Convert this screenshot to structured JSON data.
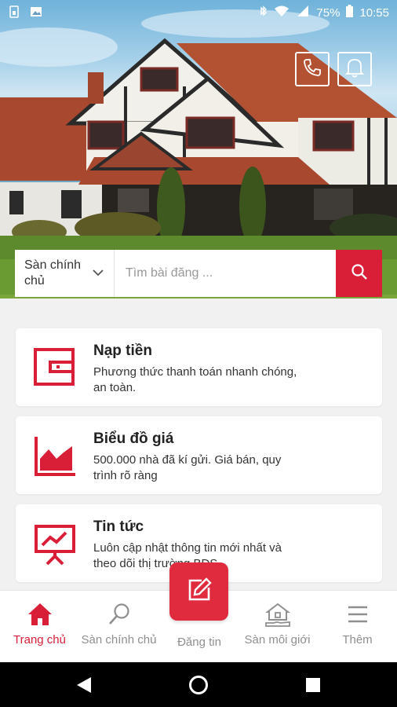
{
  "status_bar": {
    "battery": "75%",
    "time": "10:55",
    "icons": [
      "sim-icon",
      "image-icon",
      "bluetooth-icon",
      "wifi-icon",
      "signal-icon",
      "battery-icon"
    ]
  },
  "header": {
    "buttons": [
      "phone-icon",
      "bell-icon"
    ]
  },
  "search": {
    "category": "Sàn chính chủ",
    "placeholder": "Tìm bài đăng ...",
    "value": ""
  },
  "cards": [
    {
      "title": "Nạp tiền",
      "desc": "Phương thức thanh toán nhanh chóng, an toàn.",
      "icon": "wallet-icon"
    },
    {
      "title": "Biểu đồ giá",
      "desc": "500.000 nhà đã kí gửi. Giá bán, quy trình rõ ràng",
      "icon": "area-chart-icon"
    },
    {
      "title": "Tin tức",
      "desc": "Luôn cập nhật thông tin mới nhất và theo dõi thị trường BĐS",
      "icon": "presentation-icon"
    }
  ],
  "nav": {
    "items": [
      {
        "label": "Trang chủ",
        "icon": "home-icon",
        "active": true
      },
      {
        "label": "Sàn chính chủ",
        "icon": "search-icon",
        "active": false
      },
      {
        "label": "Đăng tin",
        "icon": "edit-icon",
        "active": false
      },
      {
        "label": "Sàn môi giới",
        "icon": "house-hand-icon",
        "active": false
      },
      {
        "label": "Thêm",
        "icon": "menu-icon",
        "active": false
      }
    ]
  },
  "colors": {
    "accent": "#d91f38",
    "inactive": "#8f8f8f"
  }
}
